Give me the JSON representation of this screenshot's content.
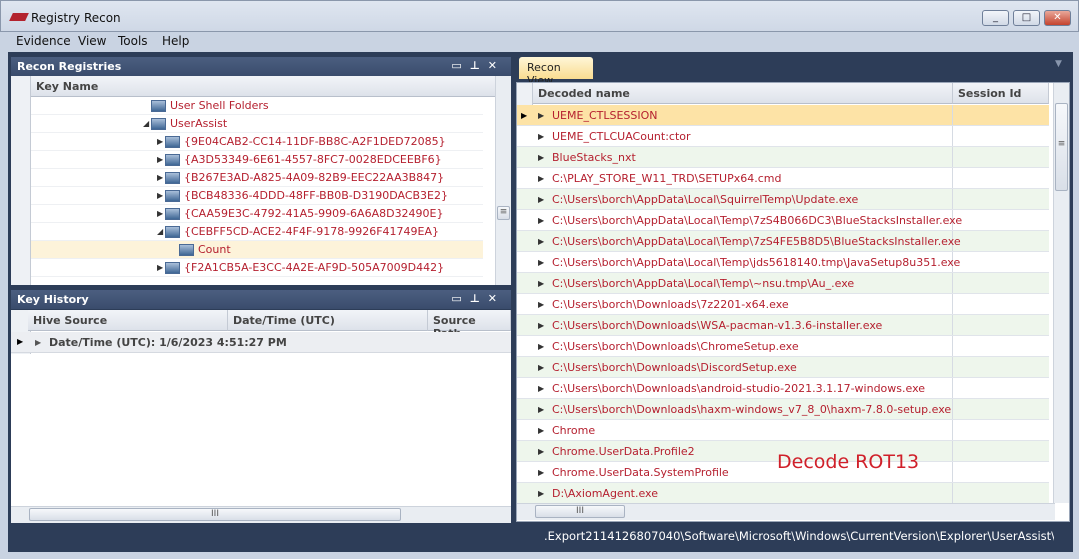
{
  "window": {
    "title": "Registry Recon",
    "controls": [
      "_",
      "□",
      "✕"
    ]
  },
  "menu": [
    "Evidence",
    "View",
    "Tools",
    "Help"
  ],
  "recon_registries": {
    "title": "Recon Registries",
    "column": "Key Name",
    "items": [
      {
        "label": "User Shell Folders",
        "level": 0,
        "expander": ""
      },
      {
        "label": "UserAssist",
        "level": 0,
        "expander": "◢"
      },
      {
        "label": "{9E04CAB2-CC14-11DF-BB8C-A2F1DED72085}",
        "level": 1,
        "expander": "▶"
      },
      {
        "label": "{A3D53349-6E61-4557-8FC7-0028EDCEEBF6}",
        "level": 1,
        "expander": "▶"
      },
      {
        "label": "{B267E3AD-A825-4A09-82B9-EEC22AA3B847}",
        "level": 1,
        "expander": "▶"
      },
      {
        "label": "{BCB48336-4DDD-48FF-BB0B-D3190DACB3E2}",
        "level": 1,
        "expander": "▶"
      },
      {
        "label": "{CAA59E3C-4792-41A5-9909-6A6A8D32490E}",
        "level": 1,
        "expander": "▶"
      },
      {
        "label": "{CEBFF5CD-ACE2-4F4F-9178-9926F41749EA}",
        "level": 1,
        "expander": "◢"
      },
      {
        "label": "Count",
        "level": 2,
        "expander": "",
        "selected": true
      },
      {
        "label": "{F2A1CB5A-E3CC-4A2E-AF9D-505A7009D442}",
        "level": 1,
        "expander": "▶"
      }
    ]
  },
  "key_history": {
    "title": "Key History",
    "columns": [
      "Hive Source",
      "Date/Time (UTC)",
      "Source Path"
    ],
    "group_row": "Date/Time (UTC): 1/6/2023 4:51:27 PM"
  },
  "recon_view": {
    "tab": "Recon View",
    "columns": [
      "Decoded name",
      "Session Id"
    ],
    "rows": [
      "UEME_CTLSESSION",
      "UEME_CTLCUACount:ctor",
      "BlueStacks_nxt",
      "C:\\PLAY_STORE_W11_TRD\\SETUPx64.cmd",
      "C:\\Users\\borch\\AppData\\Local\\SquirrelTemp\\Update.exe",
      "C:\\Users\\borch\\AppData\\Local\\Temp\\7zS4B066DC3\\BlueStacksInstaller.exe",
      "C:\\Users\\borch\\AppData\\Local\\Temp\\7zS4FE5B8D5\\BlueStacksInstaller.exe",
      "C:\\Users\\borch\\AppData\\Local\\Temp\\jds5618140.tmp\\JavaSetup8u351.exe",
      "C:\\Users\\borch\\AppData\\Local\\Temp\\~nsu.tmp\\Au_.exe",
      "C:\\Users\\borch\\Downloads\\7z2201-x64.exe",
      "C:\\Users\\borch\\Downloads\\WSA-pacman-v1.3.6-installer.exe",
      "C:\\Users\\borch\\Downloads\\ChromeSetup.exe",
      "C:\\Users\\borch\\Downloads\\DiscordSetup.exe",
      "C:\\Users\\borch\\Downloads\\android-studio-2021.3.1.17-windows.exe",
      "C:\\Users\\borch\\Downloads\\haxm-windows_v7_8_0\\haxm-7.8.0-setup.exe",
      "Chrome",
      "Chrome.UserData.Profile2",
      "Chrome.UserData.SystemProfile",
      "D:\\AxiomAgent.exe"
    ],
    "annotation": "Decode ROT13"
  },
  "status": {
    "path": ".Export2114126807040\\Software\\Microsoft\\Windows\\CurrentVersion\\Explorer\\UserAssist\\{CEBFF"
  },
  "colors": {
    "text_red": "#b5202f",
    "selected_row": "#fde3a6",
    "alt_row": "#eef6ec",
    "frame": "#2d3d58"
  }
}
